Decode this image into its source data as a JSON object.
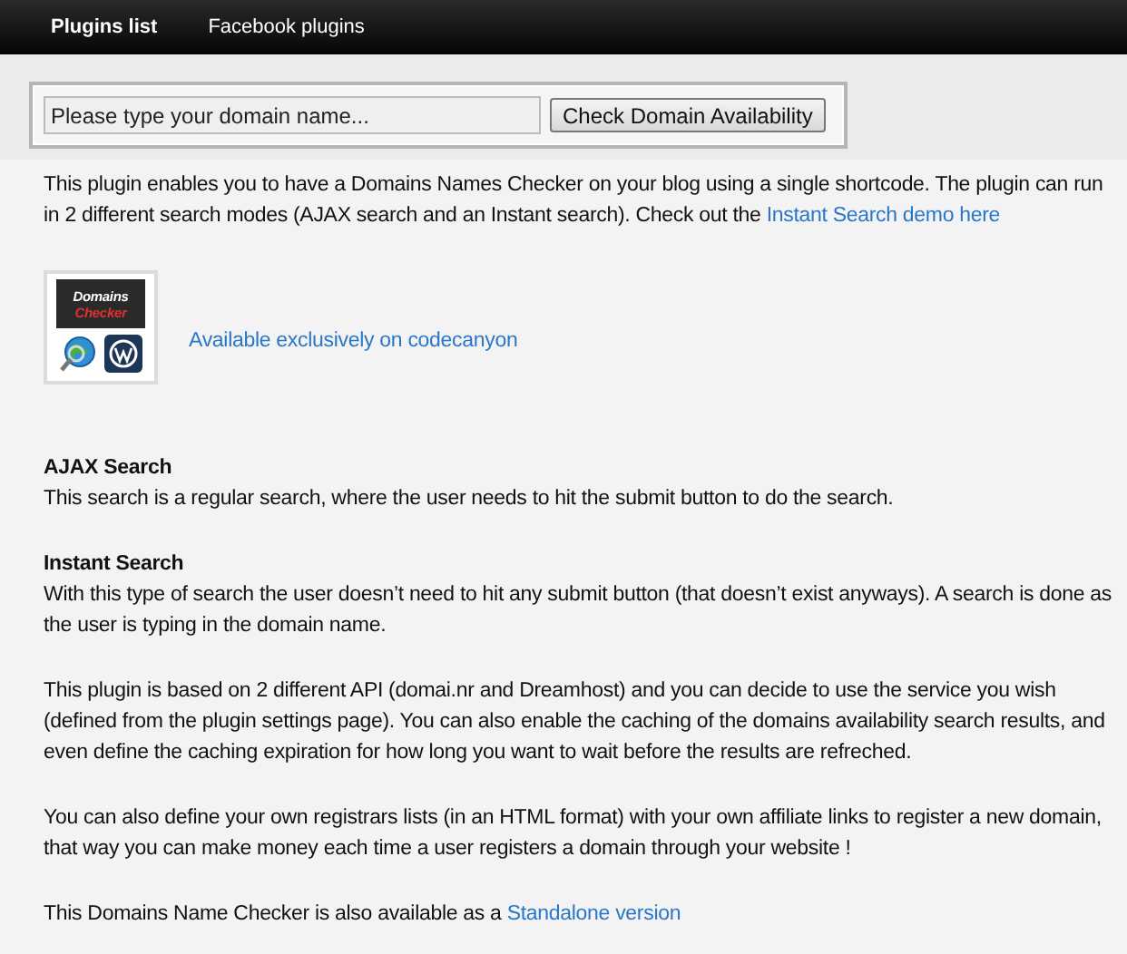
{
  "nav": [
    {
      "label": "Plugins list",
      "selected": true
    },
    {
      "label": "Facebook plugins",
      "selected": false
    }
  ],
  "search": {
    "placeholder": "Please type your domain name...",
    "button": "Check Domain Availability"
  },
  "intro": {
    "text": "This plugin enables you to have a Domains Names Checker on your blog using a single shortcode. The plugin can run in 2 different search modes (AJAX search and an Instant search). Check out the",
    "link": "Instant Search demo here"
  },
  "promo": {
    "logo_title": "Domains",
    "logo_subtitle": "Checker",
    "link": "Available exclusively on codecanyon"
  },
  "sections": [
    {
      "heading": "AJAX Search",
      "text": "This search is a regular search, where the user needs to hit the submit button to do the search."
    },
    {
      "heading": "Instant Search",
      "text": "With this type of search the user doesn’t need to hit any submit button (that doesn’t exist anyways). A search is done as the user is typing in the domain name."
    }
  ],
  "paragraphs": [
    {
      "text": "This plugin is based on 2 different API (domai.nr and Dreamhost) and you can decide to use the service you wish (defined from the plugin settings page). You can also enable the caching of the domains availability search results, and even define the caching expiration for how long you want to wait before the results are refreched."
    },
    {
      "text": "You can also define your own registrars lists (in an HTML format) with your own affiliate links to register a new domain, that way you can make money each time a user registers a domain through your website !"
    },
    {
      "text": "This Domains Name Checker is also available as a",
      "link": "Standalone version"
    }
  ]
}
